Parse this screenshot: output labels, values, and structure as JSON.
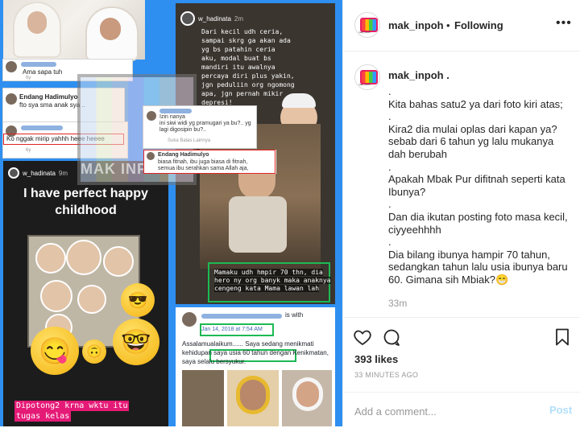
{
  "media": {
    "comment1_text": "Ama sapa tuh",
    "comment1_time": "6y",
    "comment2_name": "Endang Hadimulyo",
    "comment2_text": "fto sya sma anak sya ..",
    "comment3_text": "Ko nggak mirip yahhh heee heeee",
    "comment3_time": "6y",
    "dm_line1": "Izin nanya",
    "dm_line2": "ini siwi widi yg pramugari ya bu?.. yg",
    "dm_line3": "lagi digosipin bu?..",
    "dm_actions": "Suka   Balas   Lainnya",
    "dm2_name": "Endang Hadimulyo",
    "dm2_line1": "biasa fitnah, ibu juga biasa di fitnah,",
    "dm2_line2": "semua ibu serahkan sama Allah aja,",
    "watermark": "MAK INPOH",
    "left_story_user": "w_hadinata",
    "left_story_time": "9m",
    "left_story_title": "I have perfect happy childhood",
    "left_story_caption_1": "Dipotong2 krna wktu itu",
    "left_story_caption_2": "tugas kelas",
    "right_story_user": "w_hadinata",
    "right_story_time": "2m",
    "right_story_text": "Dari kecil udh ceria,\nsampai skrg ga akan ada\nyg bs patahin ceria\naku, modal buat bs\nmandiri itu awalnya\npercaya diri plus yakin,\njgn peduliin org ngomong\napa, jgn pernah mikir\ndepresi!",
    "right_story_caption": "Mamaku udh hmpir 70 thn, dia hero ny org banyk maka anaknya cengeng kata Mama lawan lah",
    "fb_user_suffix": "is with",
    "fb_date": "Jan 14, 2018 at 7:54 AM",
    "fb_text": "Assalamualaikum...... Saya sedang menikmati kehidupan saya usia 60 tahun dengan Kenikmatan, saya selalu bersyukur."
  },
  "header": {
    "username": "mak_inpoh",
    "separator": "•",
    "follow_status": "Following",
    "more_icon": "•••"
  },
  "caption": {
    "username": "mak_inpoh .",
    "text": ".\nKita bahas satu2 ya dari foto kiri atas;\n.\nKira2 dia mulai oplas dari kapan ya? sebab dari 6 tahun yg lalu mukanya dah berubah\n.\nApakah Mbak Pur difitnah seperti kata Ibunya?\n.\nDan dia ikutan posting foto masa kecil, ciyyeehhhh\n.\nDia bilang ibunya hampir 70 tahun, sedangkan tahun lalu usia ibunya baru 60. Gimana sih Mbiak?😁",
    "time": "33m"
  },
  "actions": {
    "likes": "393 likes",
    "posted": "33 MINUTES AGO",
    "comment_placeholder": "Add a comment...",
    "post_label": "Post"
  }
}
